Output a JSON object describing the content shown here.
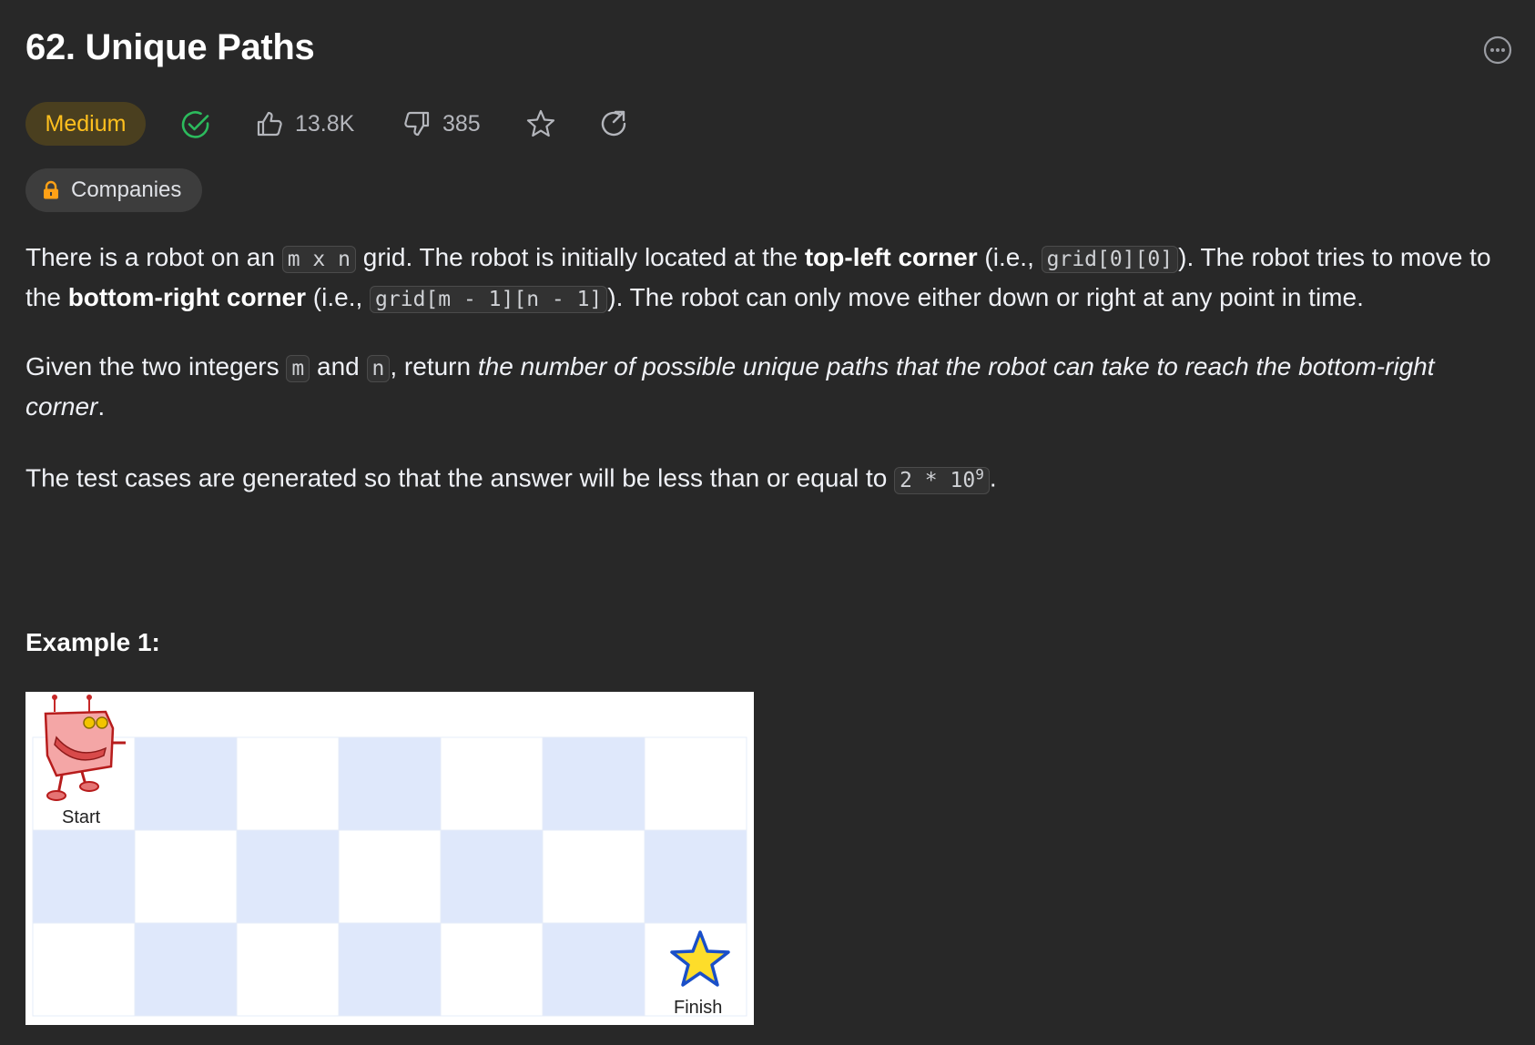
{
  "problem": {
    "title": "62. Unique Paths",
    "difficulty": "Medium",
    "likes": "13.8K",
    "dislikes": "385",
    "companies_label": "Companies"
  },
  "description": {
    "p1_a": "There is a robot on an ",
    "p1_code1": "m x n",
    "p1_b": " grid. The robot is initially located at the ",
    "p1_bold1": "top-left corner",
    "p1_c": " (i.e., ",
    "p1_code2": "grid[0][0]",
    "p1_d": "). The robot tries to move to the ",
    "p1_bold2": "bottom-right corner",
    "p1_e": " (i.e., ",
    "p1_code3": "grid[m - 1][n - 1]",
    "p1_f": "). The robot can only move either down or right at any point in time.",
    "p2_a": "Given the two integers ",
    "p2_code1": "m",
    "p2_b": " and ",
    "p2_code2": "n",
    "p2_c": ", return ",
    "p2_italic": "the number of possible unique paths that the robot can take to reach the bottom-right corner",
    "p2_d": ".",
    "p3_a": "The test cases are generated so that the answer will be less than or equal to ",
    "p3_code_base": "2 * 10",
    "p3_code_exp": "9",
    "p3_b": "."
  },
  "example": {
    "title": "Example 1:",
    "start_label": "Start",
    "finish_label": "Finish",
    "grid_rows": 3,
    "grid_cols": 7
  },
  "colors": {
    "background": "#282828",
    "medium": "#ffc01e",
    "solved": "#2cbb5d",
    "lock": "#ffa116",
    "cell_light": "#ffffff",
    "cell_blue": "#dfe8fb"
  }
}
